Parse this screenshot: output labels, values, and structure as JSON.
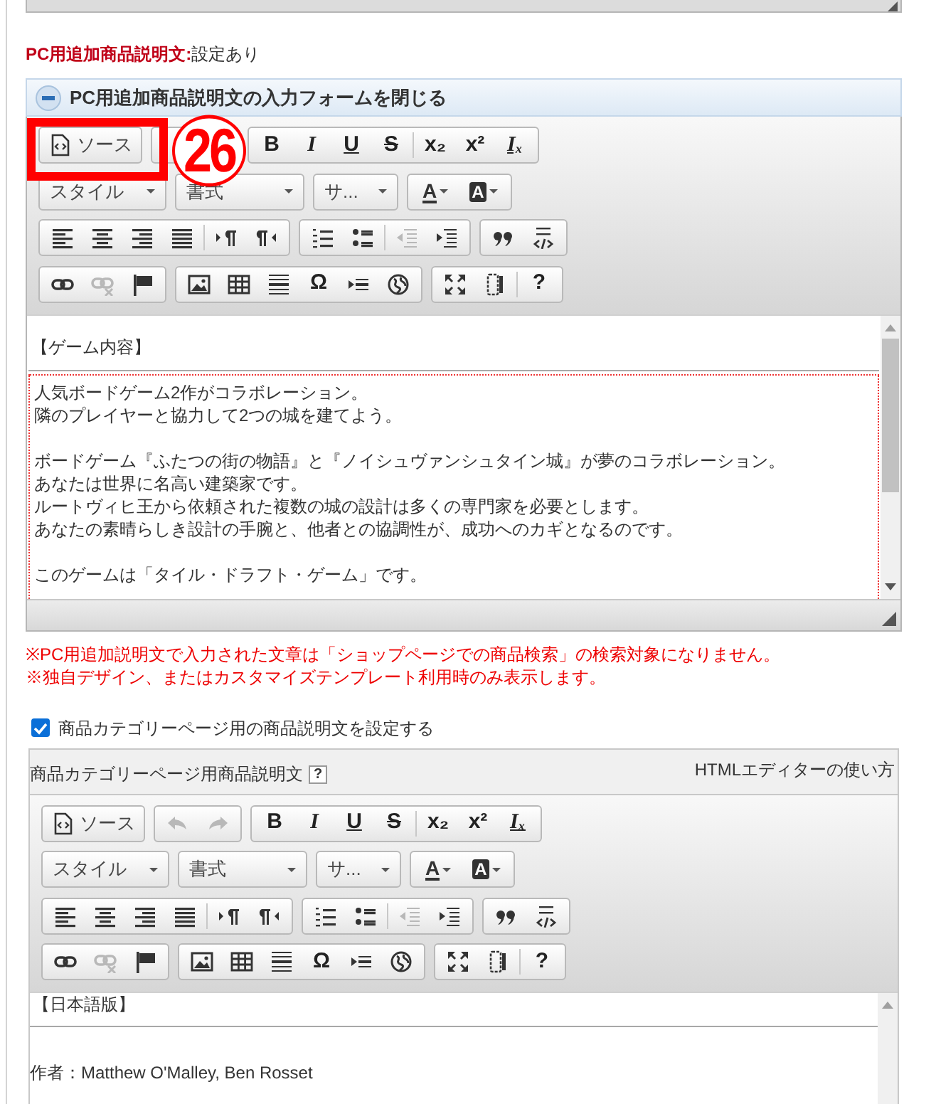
{
  "setting": {
    "label": "PC用追加商品説明文:",
    "value": "設定あり"
  },
  "collapse_bar": {
    "label": "PC用追加商品説明文の入力フォームを閉じる",
    "expanded": true
  },
  "editor_1": {
    "annotation": {
      "number": "26"
    },
    "toolbar": {
      "rows": [
        [
          {
            "kind": "source",
            "label": "ソース"
          },
          {
            "kind": "history"
          },
          {
            "kind": "buttons",
            "items": [
              {
                "kind": "bold",
                "text": "B"
              },
              {
                "kind": "italic",
                "text": "I"
              },
              {
                "kind": "underline",
                "text": "U"
              },
              {
                "kind": "strike",
                "text": "S"
              },
              {
                "kind": "sep"
              },
              {
                "kind": "plain",
                "text": "x₂"
              },
              {
                "kind": "plain",
                "text": "x²"
              },
              {
                "kind": "clear",
                "text": "Iₓ"
              }
            ]
          }
        ],
        [
          {
            "kind": "select",
            "label": "スタイル"
          },
          {
            "kind": "select",
            "label": "書式"
          },
          {
            "kind": "select",
            "label": "サ..."
          },
          {
            "kind": "buttons",
            "items": [
              {
                "kind": "text-color",
                "text": "A"
              },
              {
                "kind": "bg-color",
                "text": "A"
              }
            ]
          }
        ],
        [
          {
            "kind": "buttons",
            "items": [
              {
                "kind": "icon",
                "disabled": false
              },
              {
                "kind": "icon",
                "disabled": false
              },
              {
                "kind": "icon",
                "disabled": false
              },
              {
                "kind": "icon",
                "disabled": false
              },
              {
                "kind": "sep"
              },
              {
                "kind": "icon",
                "disabled": false
              },
              {
                "kind": "icon",
                "disabled": false
              }
            ]
          },
          {
            "kind": "buttons",
            "items": [
              {
                "kind": "icon",
                "disabled": false
              },
              {
                "kind": "icon",
                "disabled": false
              },
              {
                "kind": "sep"
              },
              {
                "kind": "icon",
                "disabled": true
              },
              {
                "kind": "icon",
                "disabled": false
              }
            ]
          },
          {
            "kind": "buttons",
            "items": [
              {
                "kind": "icon",
                "disabled": false
              },
              {
                "kind": "icon",
                "disabled": false
              }
            ]
          }
        ],
        [
          {
            "kind": "buttons",
            "items": [
              {
                "kind": "icon",
                "disabled": false
              },
              {
                "kind": "icon",
                "disabled": true
              },
              {
                "kind": "icon",
                "disabled": false
              }
            ]
          },
          {
            "kind": "buttons",
            "items": [
              {
                "kind": "icon",
                "disabled": false
              },
              {
                "kind": "icon",
                "disabled": false
              },
              {
                "kind": "icon",
                "disabled": false
              },
              {
                "kind": "plain",
                "text": "Ω"
              },
              {
                "kind": "icon",
                "disabled": false
              },
              {
                "kind": "icon",
                "disabled": false
              }
            ]
          },
          {
            "kind": "buttons",
            "items": [
              {
                "kind": "icon",
                "disabled": false
              },
              {
                "kind": "icon",
                "disabled": false
              },
              {
                "kind": "sep"
              },
              {
                "kind": "plain",
                "text": "?"
              }
            ]
          }
        ]
      ]
    },
    "content": {
      "heading": "【ゲーム内容】",
      "paragraphs": [
        [
          "人気ボードゲーム2作がコラボレーション。",
          "隣のプレイヤーと協力して2つの城を建てよう。"
        ],
        [
          "ボードゲーム『ふたつの街の物語』と『ノイシュヴァンシュタイン城』が夢のコラボレーション。",
          "あなたは世界に名高い建築家です。",
          "ルートヴィヒ王から依頼された複数の城の設計は多くの専門家を必要とします。",
          "あなたの素晴らしき設計の手腕と、他者との協調性が、成功へのカギとなるのです。"
        ],
        [
          "このゲームは「タイル・ドラフト・ゲーム」です。"
        ]
      ]
    }
  },
  "notes": [
    "※PC用追加説明文で入力された文章は「ショップページでの商品検索」の検索対象になりません。",
    "※独自デザイン、またはカスタマイズテンプレート利用時のみ表示します。"
  ],
  "category_option": {
    "label": "商品カテゴリーページ用の商品説明文を設定する",
    "checked": true
  },
  "editor_2": {
    "title": "商品カテゴリーページ用商品説明文",
    "help": "?",
    "guide_link": "HTMLエディターの使い方",
    "toolbar": {
      "rows": [
        [
          {
            "kind": "source",
            "label": "ソース"
          },
          {
            "kind": "history",
            "buttons": [
              {
                "disabled": true
              },
              {
                "disabled": true
              }
            ]
          },
          {
            "kind": "buttons",
            "items": [
              {
                "kind": "bold",
                "text": "B"
              },
              {
                "kind": "italic",
                "text": "I"
              },
              {
                "kind": "underline",
                "text": "U"
              },
              {
                "kind": "strike",
                "text": "S"
              },
              {
                "kind": "sep"
              },
              {
                "kind": "plain",
                "text": "x₂"
              },
              {
                "kind": "plain",
                "text": "x²"
              },
              {
                "kind": "clear",
                "text": "Iₓ"
              }
            ]
          }
        ],
        [
          {
            "kind": "select",
            "label": "スタイル"
          },
          {
            "kind": "select",
            "label": "書式"
          },
          {
            "kind": "select",
            "label": "サ..."
          },
          {
            "kind": "buttons",
            "items": [
              {
                "kind": "text-color",
                "text": "A"
              },
              {
                "kind": "bg-color",
                "text": "A"
              }
            ]
          }
        ],
        [
          {
            "kind": "buttons",
            "items": [
              {
                "kind": "icon",
                "disabled": false
              },
              {
                "kind": "icon",
                "disabled": false
              },
              {
                "kind": "icon",
                "disabled": false
              },
              {
                "kind": "icon",
                "disabled": false
              },
              {
                "kind": "sep"
              },
              {
                "kind": "icon",
                "disabled": false
              },
              {
                "kind": "icon",
                "disabled": false
              }
            ]
          },
          {
            "kind": "buttons",
            "items": [
              {
                "kind": "icon",
                "disabled": false
              },
              {
                "kind": "icon",
                "disabled": false
              },
              {
                "kind": "sep"
              },
              {
                "kind": "icon",
                "disabled": true
              },
              {
                "kind": "icon",
                "disabled": false
              }
            ]
          },
          {
            "kind": "buttons",
            "items": [
              {
                "kind": "icon",
                "disabled": false
              },
              {
                "kind": "icon",
                "disabled": false
              }
            ]
          }
        ],
        [
          {
            "kind": "buttons",
            "items": [
              {
                "kind": "icon",
                "disabled": false
              },
              {
                "kind": "icon",
                "disabled": true
              },
              {
                "kind": "icon",
                "disabled": false
              }
            ]
          },
          {
            "kind": "buttons",
            "items": [
              {
                "kind": "icon",
                "disabled": false
              },
              {
                "kind": "icon",
                "disabled": false
              },
              {
                "kind": "icon",
                "disabled": false
              },
              {
                "kind": "plain",
                "text": "Ω"
              },
              {
                "kind": "icon",
                "disabled": false
              },
              {
                "kind": "icon",
                "disabled": false
              }
            ]
          },
          {
            "kind": "buttons",
            "items": [
              {
                "kind": "icon",
                "disabled": false
              },
              {
                "kind": "icon",
                "disabled": false
              },
              {
                "kind": "sep"
              },
              {
                "kind": "plain",
                "text": "?"
              }
            ]
          }
        ]
      ]
    },
    "content": {
      "heading": "【日本語版】",
      "paragraphs": [
        [
          "作者：Matthew O'Malley, Ben Rosset"
        ]
      ]
    }
  }
}
